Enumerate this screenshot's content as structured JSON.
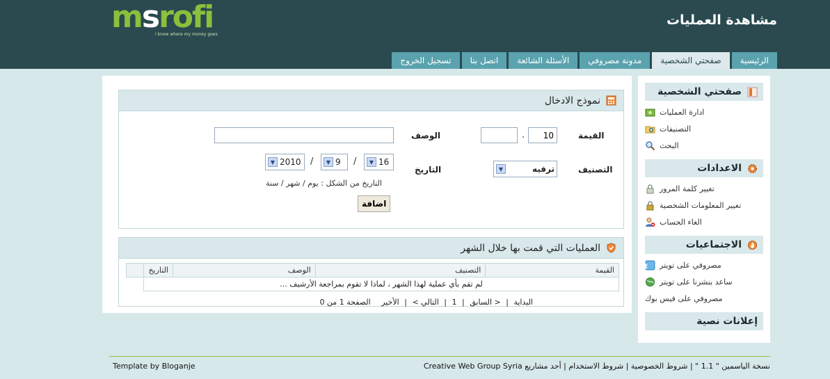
{
  "header": {
    "logo_prefix": "m",
    "logo_s": "s",
    "logo_suffix": "rofi",
    "logo_tagline": "i know where my money goes",
    "page_title": "مشاهدة العمليات"
  },
  "tabs": [
    {
      "label": "الرئيسية",
      "active": false
    },
    {
      "label": "صفحتي الشخصية",
      "active": true
    },
    {
      "label": "مدونة مصروفي",
      "active": false
    },
    {
      "label": "الأسئلة الشائعة",
      "active": false
    },
    {
      "label": "اتصل بنا",
      "active": false
    },
    {
      "label": "تسجيل الخروج",
      "active": false
    }
  ],
  "sidebar": {
    "personal": {
      "title": "صفحتي الشخصية",
      "items": [
        "ادارة العمليات",
        "التصنيفات",
        "البحث"
      ]
    },
    "settings": {
      "title": "الاعدادات",
      "items": [
        "تغيير كلمة المرور",
        "تغيير المعلومات الشخصية",
        "الغاء الحساب"
      ]
    },
    "social": {
      "title": "الاجتماعيات",
      "items": [
        "مصروفي على تويتر",
        "ساعد بنشرنا على تويتر",
        "مصروفي على فيس بوك"
      ]
    },
    "ads": {
      "title": "إعلانات نصية"
    }
  },
  "form": {
    "title": "نموذج الادخال",
    "value_label": "القيمة",
    "value_int": "10",
    "value_decimal": "",
    "decimal_point": ".",
    "description_label": "الوصف",
    "description_value": "",
    "category_label": "التصنيف",
    "category_selected": "ترفيه",
    "date_label": "التاريخ",
    "day": "16",
    "month": "9",
    "year": "2010",
    "date_sep": "/",
    "date_hint": "التاريخ من الشكل : يوم / شهر / سنة",
    "submit_label": "اضافة"
  },
  "list": {
    "title": "العمليات التي قمت بها خلال الشهر",
    "columns": [
      "القيمة",
      "التصنيف",
      "الوصف",
      "التاريخ"
    ],
    "empty_message": "لم تقم بأي عملية لهذا الشهر ، لماذا لا تقوم بمراجعة الأرشيف ...",
    "pager": {
      "first": "البداية",
      "sep": "|",
      "prev": "< السابق",
      "page": "1",
      "next": "التالي >",
      "last": "الأخير",
      "page_info": "الصفحة 1 من 0"
    }
  },
  "footer": {
    "left": "Template by Bloganje",
    "right": "نسخة الياسمين \" 1.1 \" | شروط الخصوصية | شروط الاستخدام | أحد مشاريع Creative Web Group Syria"
  },
  "colors": {
    "header_bg": "#2a4a50",
    "tab_bg": "#5aa3ae",
    "logo_green": "#8bbf3c",
    "page_bg": "#d7e8eb"
  }
}
